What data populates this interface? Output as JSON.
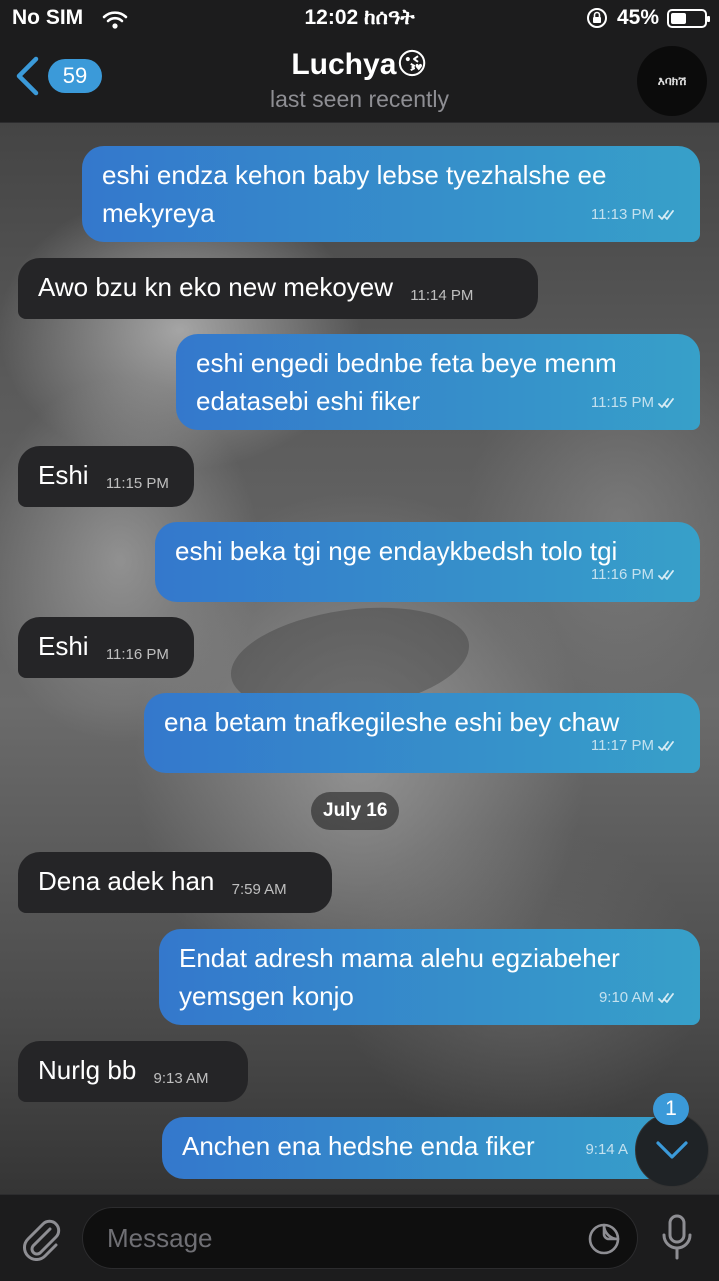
{
  "status_bar": {
    "carrier": "No SIM",
    "time": "12:02 ከሰዓት",
    "battery": "45%",
    "battery_level": 0.45
  },
  "header": {
    "back_count": "59",
    "name": "Luchya😘",
    "status": "last seen recently",
    "avatar_text": "እባክሽ"
  },
  "messages": [
    {
      "dir": "out",
      "text": "eshi endza kehon baby lebse tyezhalshe ee mekyreya",
      "time": "11:13 PM"
    },
    {
      "dir": "in",
      "text": "Awo bzu kn eko new mekoyew",
      "time": "11:14 PM"
    },
    {
      "dir": "out",
      "text": "eshi engedi bednbe feta beye menm edatasebi eshi fiker",
      "time": "11:15 PM"
    },
    {
      "dir": "in",
      "text": "Eshi",
      "time": "11:15 PM"
    },
    {
      "dir": "out",
      "text": "eshi beka tgi nge endaykbedsh tolo tgi",
      "time": "11:16 PM"
    },
    {
      "dir": "in",
      "text": "Eshi",
      "time": "11:16 PM"
    },
    {
      "dir": "out",
      "text": "ena betam tnafkegileshe eshi bey chaw",
      "time": "11:17 PM"
    },
    {
      "dir": "in",
      "text": "Dena adek han",
      "time": "7:59 AM"
    },
    {
      "dir": "out",
      "text": "Endat adresh mama alehu egziabeher yemsgen konjo",
      "time": "9:10 AM"
    },
    {
      "dir": "in",
      "text": "Nurlg bb",
      "time": "9:13 AM"
    },
    {
      "dir": "out",
      "text": "Anchen ena hedshe enda fiker",
      "time": "9:14 A"
    }
  ],
  "date_separator": "July 16",
  "scroll_badge": "1",
  "input": {
    "placeholder": "Message"
  },
  "colors": {
    "outgoing_start": "#3478cc",
    "outgoing_end": "#37a0c9",
    "incoming": "#252527",
    "accent": "#3b9ad9"
  }
}
